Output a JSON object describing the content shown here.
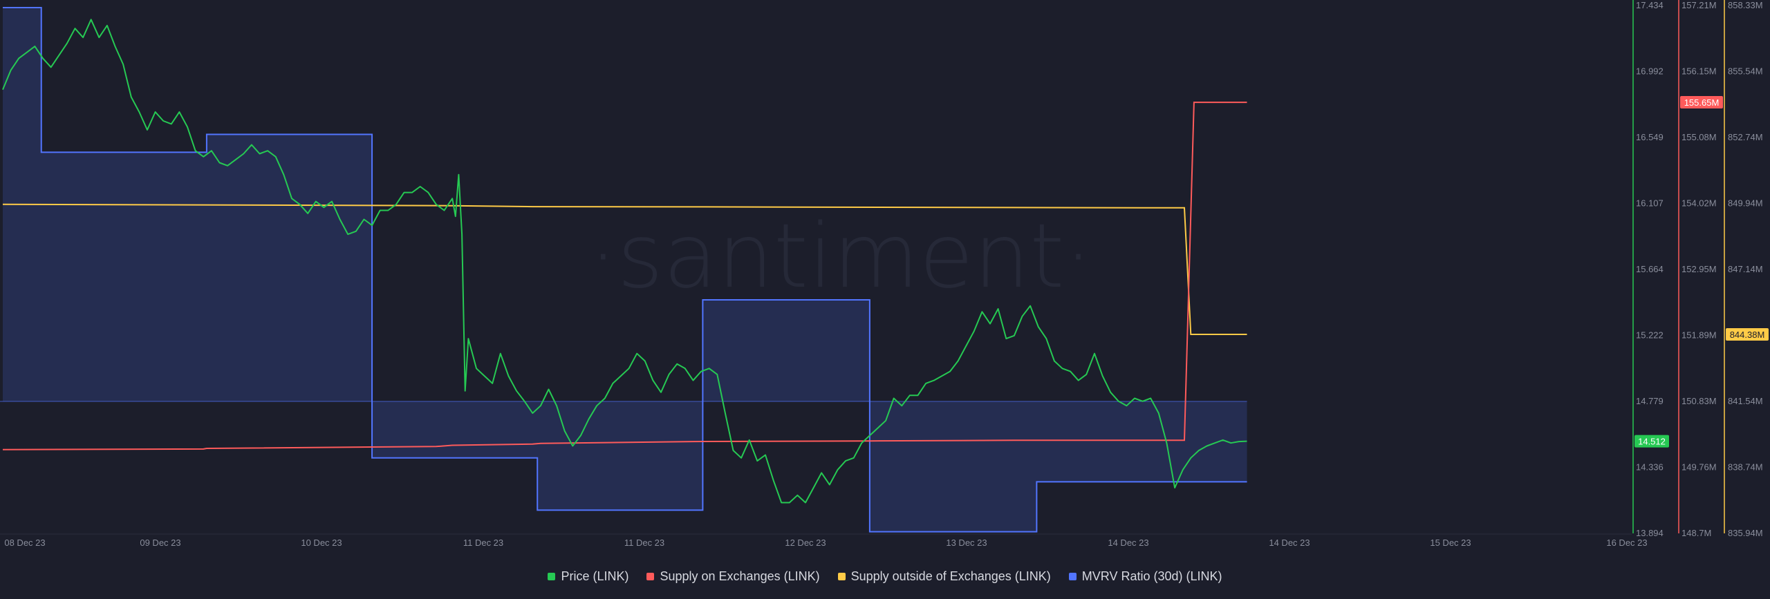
{
  "watermark": "·santiment·",
  "legend": [
    {
      "label": "Price (LINK)",
      "color": "#26c953"
    },
    {
      "label": "Supply on Exchanges (LINK)",
      "color": "#ff5b5b"
    },
    {
      "label": "Supply outside of Exchanges (LINK)",
      "color": "#ffcb47"
    },
    {
      "label": "MVRV Ratio (30d) (LINK)",
      "color": "#5275ff"
    }
  ],
  "chart_data": {
    "type": "line",
    "title": "",
    "xlabel": "",
    "ylabel": "",
    "grid": false,
    "legend_position": "bottom-center",
    "x_ticks": [
      "08 Dec 23",
      "09 Dec 23",
      "10 Dec 23",
      "11 Dec 23",
      "11 Dec 23",
      "12 Dec 23",
      "13 Dec 23",
      "14 Dec 23",
      "14 Dec 23",
      "15 Dec 23",
      "16 Dec 23"
    ],
    "axes": {
      "price": {
        "ticks": [
          "17.434",
          "16.992",
          "16.549",
          "16.107",
          "15.664",
          "15.222",
          "14.779",
          "14.336",
          "13.894"
        ],
        "range": [
          13.894,
          17.434
        ],
        "color": "#26c953"
      },
      "supply_on_exchanges": {
        "ticks": [
          "157.21M",
          "156.15M",
          "155.08M",
          "154.02M",
          "152.95M",
          "151.89M",
          "150.83M",
          "149.76M",
          "148.7M"
        ],
        "range": [
          148.7,
          157.21
        ],
        "unit": "M",
        "color": "#ff5b5b"
      },
      "supply_outside_exchanges": {
        "ticks": [
          "858.33M",
          "855.54M",
          "852.74M",
          "849.94M",
          "847.14M",
          "844.34M",
          "841.54M",
          "838.74M",
          "835.94M"
        ],
        "range": [
          835.94,
          858.33
        ],
        "unit": "M",
        "color": "#ffcb47"
      }
    },
    "current_values": {
      "price": "14.512",
      "supply_on_exchanges": "155.65M",
      "supply_outside_exchanges": "844.38M"
    },
    "x_range_days": [
      0,
      8.05
    ],
    "series": [
      {
        "name": "Price (LINK)",
        "axis": "price",
        "color": "#26c953",
        "points": [
          [
            0.0,
            16.87
          ],
          [
            0.05,
            17.0
          ],
          [
            0.1,
            17.08
          ],
          [
            0.15,
            17.12
          ],
          [
            0.2,
            17.16
          ],
          [
            0.25,
            17.08
          ],
          [
            0.3,
            17.02
          ],
          [
            0.35,
            17.1
          ],
          [
            0.4,
            17.18
          ],
          [
            0.45,
            17.28
          ],
          [
            0.5,
            17.22
          ],
          [
            0.55,
            17.34
          ],
          [
            0.6,
            17.22
          ],
          [
            0.65,
            17.3
          ],
          [
            0.7,
            17.16
          ],
          [
            0.75,
            17.04
          ],
          [
            0.8,
            16.82
          ],
          [
            0.85,
            16.72
          ],
          [
            0.9,
            16.6
          ],
          [
            0.95,
            16.72
          ],
          [
            1.0,
            16.66
          ],
          [
            1.05,
            16.64
          ],
          [
            1.1,
            16.72
          ],
          [
            1.15,
            16.62
          ],
          [
            1.2,
            16.46
          ],
          [
            1.25,
            16.42
          ],
          [
            1.3,
            16.46
          ],
          [
            1.35,
            16.38
          ],
          [
            1.4,
            16.36
          ],
          [
            1.45,
            16.4
          ],
          [
            1.5,
            16.44
          ],
          [
            1.55,
            16.5
          ],
          [
            1.6,
            16.44
          ],
          [
            1.65,
            16.46
          ],
          [
            1.7,
            16.42
          ],
          [
            1.75,
            16.3
          ],
          [
            1.8,
            16.14
          ],
          [
            1.85,
            16.1
          ],
          [
            1.9,
            16.04
          ],
          [
            1.95,
            16.12
          ],
          [
            2.0,
            16.08
          ],
          [
            2.05,
            16.12
          ],
          [
            2.1,
            16.0
          ],
          [
            2.15,
            15.9
          ],
          [
            2.2,
            15.92
          ],
          [
            2.25,
            16.0
          ],
          [
            2.3,
            15.96
          ],
          [
            2.35,
            16.06
          ],
          [
            2.4,
            16.06
          ],
          [
            2.45,
            16.1
          ],
          [
            2.5,
            16.18
          ],
          [
            2.55,
            16.18
          ],
          [
            2.6,
            16.22
          ],
          [
            2.65,
            16.18
          ],
          [
            2.7,
            16.1
          ],
          [
            2.75,
            16.06
          ],
          [
            2.8,
            16.14
          ],
          [
            2.82,
            16.02
          ],
          [
            2.84,
            16.3
          ],
          [
            2.86,
            15.9
          ],
          [
            2.88,
            14.85
          ],
          [
            2.9,
            15.2
          ],
          [
            2.95,
            15.0
          ],
          [
            3.0,
            14.95
          ],
          [
            3.05,
            14.9
          ],
          [
            3.1,
            15.1
          ],
          [
            3.15,
            14.95
          ],
          [
            3.2,
            14.85
          ],
          [
            3.25,
            14.78
          ],
          [
            3.3,
            14.7
          ],
          [
            3.35,
            14.75
          ],
          [
            3.4,
            14.86
          ],
          [
            3.45,
            14.75
          ],
          [
            3.5,
            14.58
          ],
          [
            3.55,
            14.48
          ],
          [
            3.6,
            14.55
          ],
          [
            3.65,
            14.66
          ],
          [
            3.7,
            14.75
          ],
          [
            3.75,
            14.8
          ],
          [
            3.8,
            14.9
          ],
          [
            3.85,
            14.95
          ],
          [
            3.9,
            15.0
          ],
          [
            3.95,
            15.1
          ],
          [
            4.0,
            15.05
          ],
          [
            4.05,
            14.92
          ],
          [
            4.1,
            14.84
          ],
          [
            4.15,
            14.96
          ],
          [
            4.2,
            15.03
          ],
          [
            4.25,
            15.0
          ],
          [
            4.3,
            14.92
          ],
          [
            4.35,
            14.98
          ],
          [
            4.4,
            15.0
          ],
          [
            4.45,
            14.96
          ],
          [
            4.5,
            14.7
          ],
          [
            4.55,
            14.45
          ],
          [
            4.6,
            14.4
          ],
          [
            4.65,
            14.52
          ],
          [
            4.7,
            14.38
          ],
          [
            4.75,
            14.42
          ],
          [
            4.8,
            14.25
          ],
          [
            4.85,
            14.1
          ],
          [
            4.9,
            14.1
          ],
          [
            4.95,
            14.15
          ],
          [
            5.0,
            14.1
          ],
          [
            5.05,
            14.2
          ],
          [
            5.1,
            14.3
          ],
          [
            5.15,
            14.22
          ],
          [
            5.2,
            14.32
          ],
          [
            5.25,
            14.38
          ],
          [
            5.3,
            14.4
          ],
          [
            5.35,
            14.5
          ],
          [
            5.4,
            14.55
          ],
          [
            5.45,
            14.6
          ],
          [
            5.5,
            14.65
          ],
          [
            5.55,
            14.8
          ],
          [
            5.6,
            14.75
          ],
          [
            5.65,
            14.82
          ],
          [
            5.7,
            14.82
          ],
          [
            5.75,
            14.9
          ],
          [
            5.8,
            14.92
          ],
          [
            5.85,
            14.95
          ],
          [
            5.9,
            14.98
          ],
          [
            5.95,
            15.05
          ],
          [
            6.0,
            15.15
          ],
          [
            6.05,
            15.25
          ],
          [
            6.1,
            15.38
          ],
          [
            6.15,
            15.3
          ],
          [
            6.2,
            15.4
          ],
          [
            6.25,
            15.2
          ],
          [
            6.3,
            15.22
          ],
          [
            6.35,
            15.35
          ],
          [
            6.4,
            15.42
          ],
          [
            6.45,
            15.28
          ],
          [
            6.5,
            15.2
          ],
          [
            6.55,
            15.05
          ],
          [
            6.6,
            15.0
          ],
          [
            6.65,
            14.98
          ],
          [
            6.7,
            14.92
          ],
          [
            6.75,
            14.96
          ],
          [
            6.8,
            15.1
          ],
          [
            6.85,
            14.95
          ],
          [
            6.9,
            14.84
          ],
          [
            6.95,
            14.78
          ],
          [
            7.0,
            14.75
          ],
          [
            7.05,
            14.8
          ],
          [
            7.1,
            14.78
          ],
          [
            7.15,
            14.8
          ],
          [
            7.2,
            14.7
          ],
          [
            7.25,
            14.5
          ],
          [
            7.3,
            14.2
          ],
          [
            7.35,
            14.32
          ],
          [
            7.4,
            14.4
          ],
          [
            7.45,
            14.45
          ],
          [
            7.5,
            14.48
          ],
          [
            7.55,
            14.5
          ],
          [
            7.6,
            14.52
          ],
          [
            7.65,
            14.5
          ],
          [
            7.7,
            14.51
          ],
          [
            7.75,
            14.512
          ]
        ]
      },
      {
        "name": "Supply on Exchanges (LINK)",
        "axis": "supply_on_exchanges",
        "color": "#ff5b5b",
        "points": [
          [
            0.0,
            150.05
          ],
          [
            1.25,
            150.06
          ],
          [
            1.27,
            150.07
          ],
          [
            2.7,
            150.1
          ],
          [
            2.8,
            150.12
          ],
          [
            3.3,
            150.14
          ],
          [
            3.35,
            150.15
          ],
          [
            4.3,
            150.18
          ],
          [
            5.4,
            150.19
          ],
          [
            6.3,
            150.2
          ],
          [
            7.36,
            150.2
          ],
          [
            7.42,
            155.65
          ],
          [
            7.75,
            155.65
          ]
        ]
      },
      {
        "name": "Supply outside of Exchanges (LINK)",
        "axis": "supply_outside_exchanges",
        "color": "#ffcb47",
        "points": [
          [
            0.0,
            849.9
          ],
          [
            2.8,
            849.84
          ],
          [
            3.3,
            849.8
          ],
          [
            4.3,
            849.79
          ],
          [
            6.3,
            849.76
          ],
          [
            7.36,
            849.75
          ],
          [
            7.4,
            844.38
          ],
          [
            7.75,
            844.38
          ]
        ]
      },
      {
        "name": "MVRV Ratio (30d) (LINK)",
        "axis": "mvrv",
        "color": "#5275ff",
        "mvrv_axis_note": "no scale shown; baseline at the 14.779 price-level line",
        "baseline_price_level": 14.779,
        "steps": [
          {
            "from": 0.0,
            "to": 0.24,
            "value": 17.42
          },
          {
            "from": 0.24,
            "to": 1.27,
            "value": 16.45
          },
          {
            "from": 1.27,
            "to": 2.3,
            "value": 16.57
          },
          {
            "from": 2.3,
            "to": 3.33,
            "value": 14.4
          },
          {
            "from": 3.33,
            "to": 4.36,
            "value": 14.05
          },
          {
            "from": 4.36,
            "to": 5.4,
            "value": 15.46
          },
          {
            "from": 5.4,
            "to": 6.44,
            "value": 13.905
          },
          {
            "from": 6.44,
            "to": 6.55,
            "value": 14.24
          },
          {
            "from": 6.55,
            "to": 7.75,
            "value": 14.24
          }
        ]
      }
    ]
  }
}
